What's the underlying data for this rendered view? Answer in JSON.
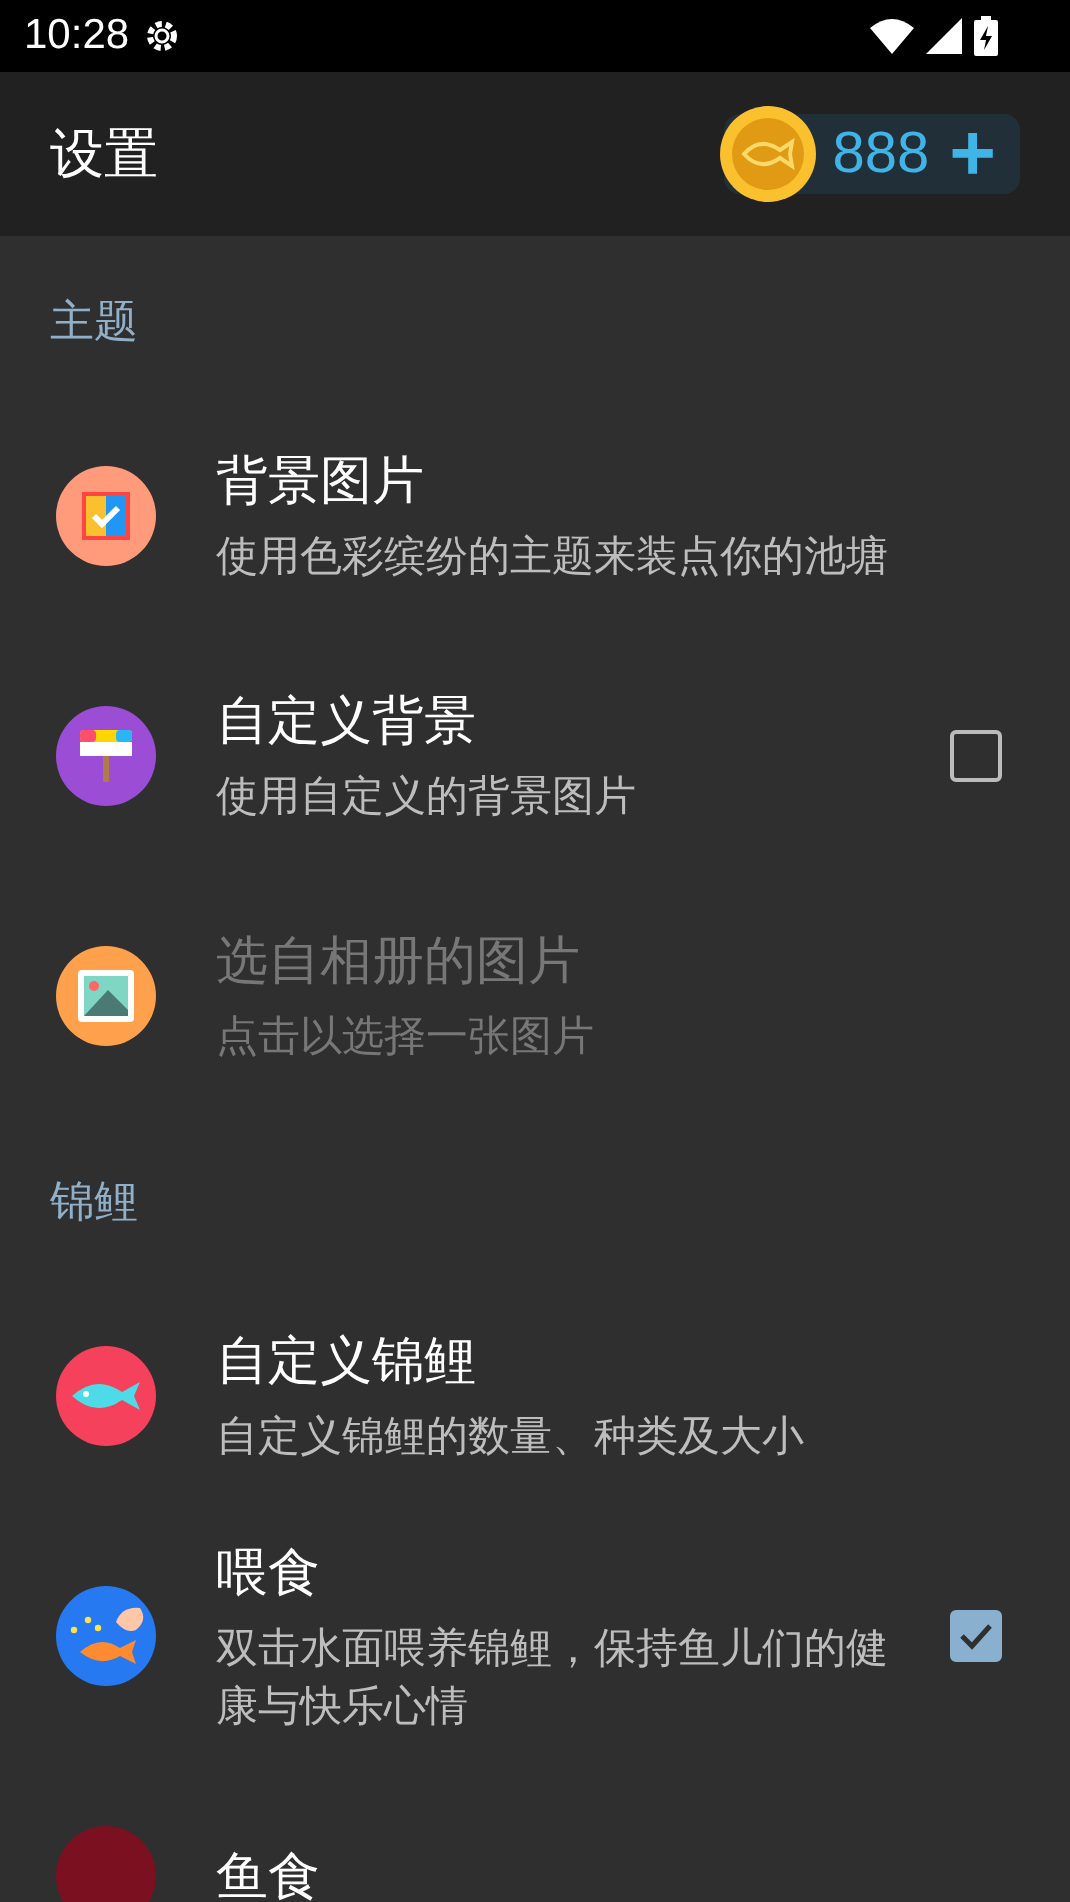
{
  "status_bar": {
    "time": "10:28"
  },
  "app_bar": {
    "title": "设置",
    "coins": "888",
    "add": "+"
  },
  "sections": [
    {
      "title": "主题",
      "items": [
        {
          "kind": "plain",
          "title": "背景图片",
          "subtitle": "使用色彩缤纷的主题来装点你的池塘",
          "disabled": false
        },
        {
          "kind": "checkbox",
          "title": "自定义背景",
          "subtitle": "使用自定义的背景图片",
          "checked": false,
          "disabled": false
        },
        {
          "kind": "plain",
          "title": "选自相册的图片",
          "subtitle": "点击以选择一张图片",
          "disabled": true
        }
      ]
    },
    {
      "title": "锦鲤",
      "items": [
        {
          "kind": "plain",
          "title": "自定义锦鲤",
          "subtitle": "自定义锦鲤的数量、种类及大小",
          "disabled": false
        },
        {
          "kind": "checkbox",
          "title": "喂食",
          "subtitle": "双击水面喂养锦鲤，保持鱼儿们的健康与快乐心情",
          "checked": true,
          "disabled": false
        },
        {
          "kind": "plain",
          "title": "鱼食",
          "disabled": false
        }
      ]
    }
  ]
}
